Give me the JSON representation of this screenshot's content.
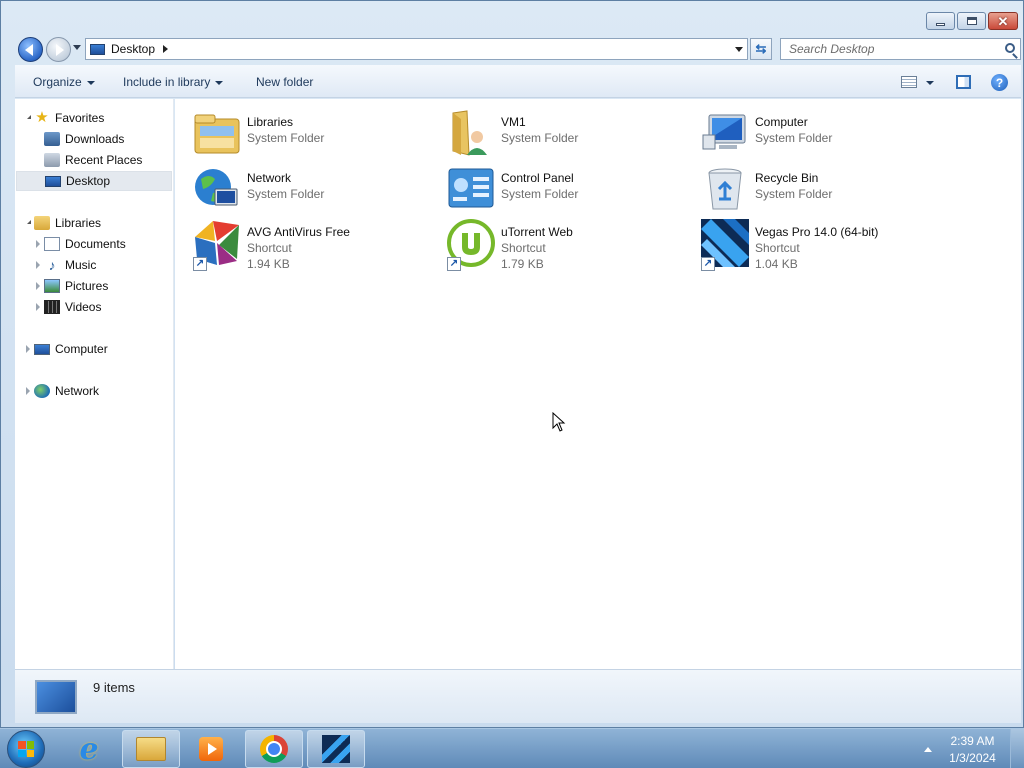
{
  "address_bar": {
    "location": "Desktop",
    "search_placeholder": "Search Desktop"
  },
  "command_bar": {
    "organize": "Organize",
    "include_in_library": "Include in library",
    "new_folder": "New folder",
    "help": "?"
  },
  "nav_pane": {
    "favorites": {
      "label": "Favorites",
      "items": [
        "Downloads",
        "Recent Places",
        "Desktop"
      ]
    },
    "libraries": {
      "label": "Libraries",
      "items": [
        "Documents",
        "Music",
        "Pictures",
        "Videos"
      ]
    },
    "computer": "Computer",
    "network": "Network",
    "selected": "Desktop"
  },
  "items": [
    {
      "name": "Libraries",
      "type": "System Folder",
      "icon": "libraries-icon"
    },
    {
      "name": "VM1",
      "type": "System Folder",
      "icon": "user-folder-icon"
    },
    {
      "name": "Computer",
      "type": "System Folder",
      "icon": "computer-icon"
    },
    {
      "name": "Network",
      "type": "System Folder",
      "icon": "network-icon"
    },
    {
      "name": "Control Panel",
      "type": "System Folder",
      "icon": "control-panel-icon"
    },
    {
      "name": "Recycle Bin",
      "type": "System Folder",
      "icon": "recycle-bin-icon"
    },
    {
      "name": "AVG AntiVirus Free",
      "type": "Shortcut",
      "size": "1.94 KB",
      "icon": "avg-icon"
    },
    {
      "name": "uTorrent Web",
      "type": "Shortcut",
      "size": "1.79 KB",
      "icon": "utorrent-icon"
    },
    {
      "name": "Vegas Pro 14.0 (64-bit)",
      "type": "Shortcut",
      "size": "1.04 KB",
      "icon": "vegas-icon"
    }
  ],
  "details": {
    "item_count": "9 items"
  },
  "taskbar": {
    "time": "2:39 AM",
    "date": "1/3/2024"
  }
}
